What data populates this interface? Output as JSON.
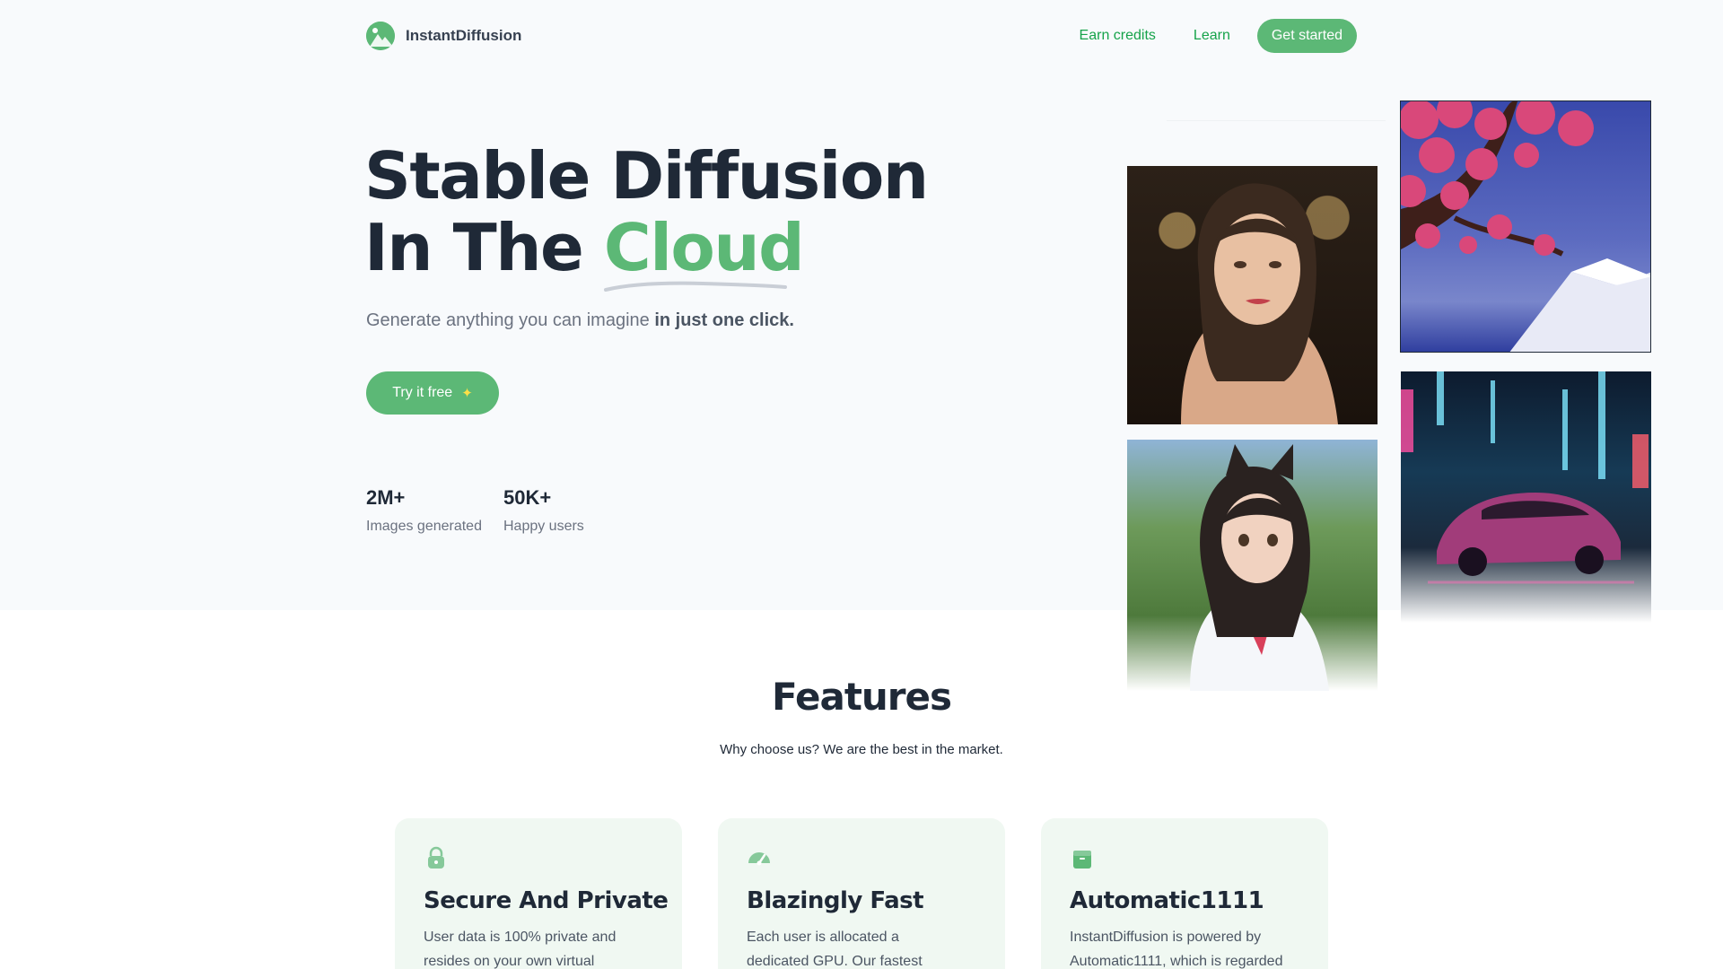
{
  "brand": {
    "name": "InstantDiffusion"
  },
  "nav": {
    "earn_credits": "Earn credits",
    "learn": "Learn",
    "get_started": "Get started"
  },
  "hero": {
    "title_line1": "Stable Diffusion",
    "title_line2_prefix": "In The",
    "title_line2_accent": "Cloud",
    "subtitle_plain": "Generate anything you can imagine",
    "subtitle_bold": "in just one click.",
    "cta_label": "Try it free",
    "cta_icon": "sparkles-icon"
  },
  "stats": [
    {
      "value": "2M+",
      "label": "Images generated"
    },
    {
      "value": "50K+",
      "label": "Happy users"
    }
  ],
  "features": {
    "title": "Features",
    "subtitle": "Why choose us? We are the best in the market.",
    "cards": [
      {
        "icon": "lock-icon",
        "title": "Secure And Private",
        "text": "User data is 100% private and resides on your own virtual"
      },
      {
        "icon": "speedometer-icon",
        "title": "Blazingly Fast",
        "text": "Each user is allocated a dedicated GPU. Our fastest"
      },
      {
        "icon": "box-icon",
        "title": "Automatic1111",
        "text": "InstantDiffusion is powered by Automatic1111, which is regarded"
      }
    ]
  },
  "colors": {
    "accent": "#5cb876",
    "accent_text": "#16a34a",
    "card_bg": "#f0f8f2",
    "heading": "#1f2937"
  }
}
